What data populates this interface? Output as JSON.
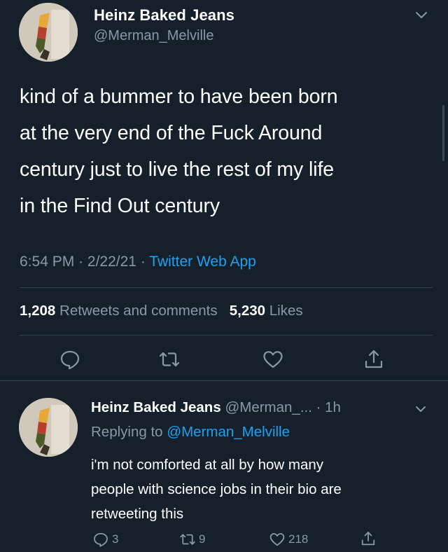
{
  "main_tweet": {
    "display_name": "Heinz Baked Jeans",
    "handle": "@Merman_Melville",
    "text_lines": [
      "kind of a bummer to have been born",
      "at the very end of the Fuck Around",
      "century just to live the rest of my life",
      "in the Find Out century"
    ],
    "time": "6:54 PM",
    "date": "2/22/21",
    "separator": "·",
    "source": "Twitter Web App",
    "retweets_count": "1,208",
    "retweets_label": "Retweets and comments",
    "likes_count": "5,230",
    "likes_label": "Likes",
    "actions": [
      "reply-icon",
      "retweet-icon",
      "like-icon",
      "share-icon"
    ]
  },
  "reply_tweet": {
    "display_name": "Heinz Baked Jeans",
    "handle_truncated": "@Merman_...",
    "age": "· 1h",
    "replying_prefix": "Replying to",
    "replying_to": "@Merman_Melville",
    "text_lines": [
      "i'm not comforted at all by how many",
      "people with science jobs in their bio are",
      "retweeting this"
    ],
    "reply_count": "3",
    "retweet_count": "9",
    "like_count": "218"
  },
  "colors": {
    "background": "#15202b",
    "secondary_text": "#8899a6",
    "link": "#1da1f2",
    "divider": "#38444d"
  }
}
